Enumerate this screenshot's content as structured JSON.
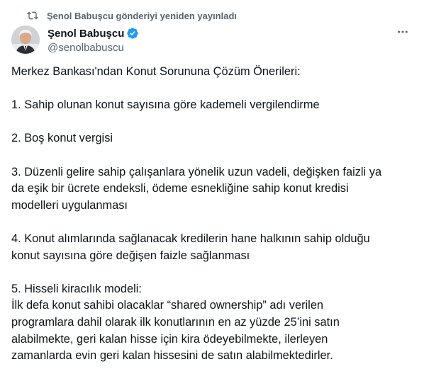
{
  "repost": {
    "text": "Şenol Babuşcu gönderiyi yeniden yayınladı",
    "icon": "repost-icon"
  },
  "author": {
    "name": "Şenol Babuşcu",
    "handle": "@senolbabuscu",
    "verified_color": "#1d9bf0"
  },
  "tweet": {
    "title": "Merkez Bankası'ndan Konut Sorununa Çözüm Önerileri:",
    "item1": "1. Sahip olunan konut sayısına göre kademeli vergilendirme",
    "item2": "2. Boş konut vergisi",
    "item3_line1": "3. Düzenli gelire sahip çalışanlara yönelik uzun vadeli, değişken faizli ya",
    "item3_line2": "da eşik bir ücrete endeksli, ödeme esnekliğine sahip konut kredisi",
    "item3_line3": "modelleri uygulanması",
    "item4_line1": "4. Konut alımlarında sağlanacak kredilerin hane halkının sahip olduğu",
    "item4_line2": "konut sayısına göre değişen faizle sağlanması",
    "item5_title": "5. Hisseli kiracılık modeli:",
    "item5_line1": "İlk defa konut sahibi olacaklar “shared ownership” adı verilen",
    "item5_line2": "programlara dahil olarak ilk konutlarının en az yüzde 25’ini satın",
    "item5_line3": "alabilmekte, geri kalan hisse için kira ödeyebilmekte, ilerleyen",
    "item5_line4": "zamanlarda evin geri kalan hissesini de satın alabilmektedirler."
  }
}
